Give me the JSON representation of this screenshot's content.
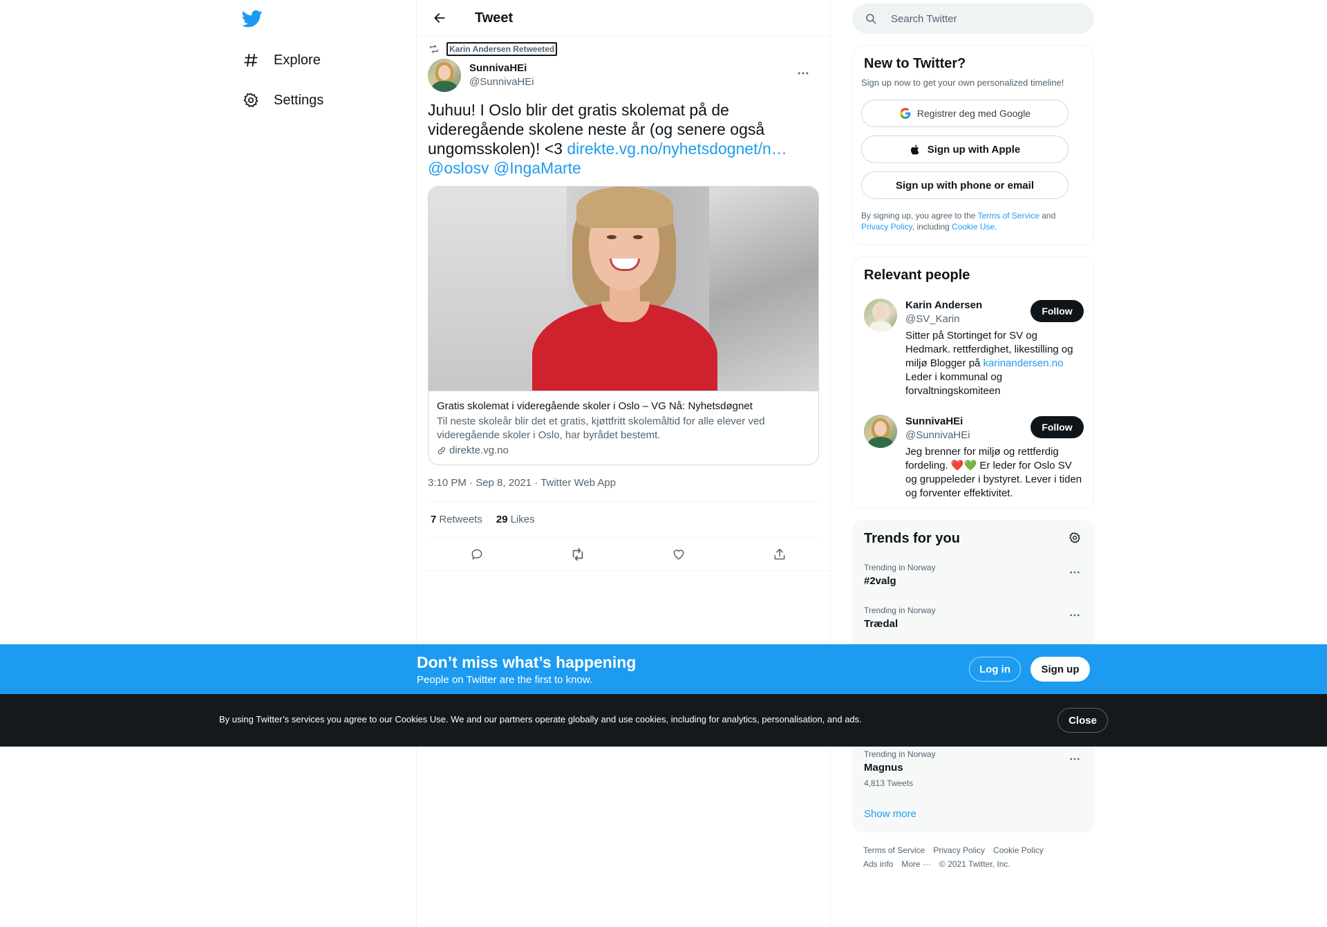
{
  "nav": {
    "logo_icon": "twitter-bird-icon",
    "items": [
      {
        "label": "Explore",
        "icon": "hashtag-icon"
      },
      {
        "label": "Settings",
        "icon": "gear-icon"
      }
    ]
  },
  "header": {
    "title": "Tweet",
    "back_icon": "back-arrow-icon"
  },
  "tweet": {
    "retweeted_by": "Karin Andersen Retweeted",
    "author_name": "SunnivaHEi",
    "author_handle": "@SunnivaHEi",
    "text": "Juhuu! I Oslo blir det gratis skolemat på de videregående skolene neste år (og senere også ungomsskolen)! <3 ",
    "link_text": "direkte.vg.no/nyhetsdognet/n…",
    "mention_1": "@oslosv",
    "mention_2": "@IngaMarte",
    "card": {
      "title": "Gratis skolemat i videregående skoler i Oslo – VG Nå: Nyhetsdøgnet",
      "description": "Til neste skoleår blir det et gratis, kjøttfritt skolemåltid for alle elever ved videregående skoler i Oslo, har byrådet bestemt.",
      "domain": "direkte.vg.no"
    },
    "meta": "3:10 PM · Sep 8, 2021 · Twitter Web App",
    "retweets_count": "7",
    "retweets_label": "Retweets",
    "likes_count": "29",
    "likes_label": "Likes"
  },
  "search": {
    "placeholder": "Search Twitter"
  },
  "new_to_twitter": {
    "title": "New to Twitter?",
    "subtitle": "Sign up now to get your own personalized timeline!",
    "google_label": "Registrer deg med Google",
    "apple_label": "Sign up with Apple",
    "phone_label": "Sign up with phone or email",
    "legal_prefix": "By signing up, you agree to the ",
    "terms": "Terms of Service",
    "and": " and ",
    "privacy": "Privacy Policy",
    "including": ", including ",
    "cookie": "Cookie Use."
  },
  "relevant_people": {
    "title": "Relevant people",
    "people": [
      {
        "name": "Karin Andersen",
        "handle": "@SV_Karin",
        "bio_before": "Sitter på Stortinget for SV og Hedmark. rettferdighet, likestilling og miljø Blogger på ",
        "bio_link": "karinandersen.no",
        "bio_after": " Leder i kommunal og forvaltningskomiteen",
        "follow_label": "Follow"
      },
      {
        "name": "SunnivaHEi",
        "handle": "@SunnivaHEi",
        "bio_before": "Jeg brenner for miljø og rettferdig fordeling. ",
        "bio_emoji": "❤️💚",
        "bio_after": " Er leder for Oslo SV og gruppeleder i bystyret. Lever i tiden og forventer effektivitet.",
        "follow_label": "Follow"
      }
    ]
  },
  "trends": {
    "title": "Trends for you",
    "items": [
      {
        "context": "Trending in Norway",
        "name": "#2valg",
        "count": ""
      },
      {
        "context": "Trending in Norway",
        "name": "Trædal",
        "count": ""
      },
      {
        "context": "Trending in Norway",
        "name": "Magnus",
        "count": "4,813 Tweets"
      }
    ],
    "show_more": "Show more"
  },
  "footer": {
    "links": [
      "Terms of Service",
      "Privacy Policy",
      "Cookie Policy",
      "Ads info",
      "More ···",
      "© 2021 Twitter, Inc."
    ]
  },
  "banner": {
    "title": "Don’t miss what’s happening",
    "subtitle": "People on Twitter are the first to know.",
    "login_label": "Log in",
    "signup_label": "Sign up"
  },
  "cookie_banner": {
    "text": "By using Twitter’s services you agree to our Cookies Use. We and our partners operate globally and use cookies, including for analytics, personalisation, and ads.",
    "close_label": "Close"
  },
  "colors": {
    "accent": "#1d9bf0",
    "text": "#0f1419",
    "muted": "#536471",
    "cookie_bg": "#16191c"
  }
}
